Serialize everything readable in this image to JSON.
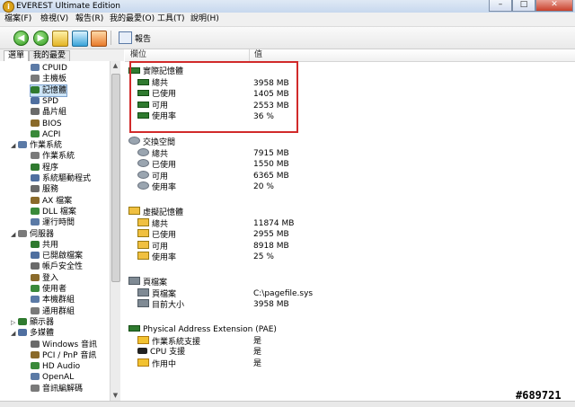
{
  "window": {
    "title": "EVEREST Ultimate Edition",
    "app_icon": "i",
    "min": "–",
    "max": "□",
    "close": "✕"
  },
  "menu": [
    "檔案(F)",
    "檢視(V)",
    "報告(R)",
    "我的最愛(O)",
    "工具(T)",
    "說明(H)"
  ],
  "toolbar": {
    "report_label": "報告",
    "back": "◀",
    "forward": "▶"
  },
  "tabs": {
    "menu": "選單",
    "favorites": "我的最愛"
  },
  "tree": [
    {
      "label": "CPUID",
      "icon": "cpu-icon",
      "indent": 2
    },
    {
      "label": "主機板",
      "icon": "motherboard-icon",
      "indent": 2
    },
    {
      "label": "記憶體",
      "icon": "memory-icon",
      "indent": 2,
      "selected": true
    },
    {
      "label": "SPD",
      "icon": "spd-icon",
      "indent": 2
    },
    {
      "label": "晶片組",
      "icon": "chipset-icon",
      "indent": 2
    },
    {
      "label": "BIOS",
      "icon": "bios-icon",
      "indent": 2
    },
    {
      "label": "ACPI",
      "icon": "acpi-icon",
      "indent": 2
    },
    {
      "label": "作業系統",
      "icon": "windows-icon",
      "indent": 1,
      "expander": "◢"
    },
    {
      "label": "作業系統",
      "icon": "windows-icon",
      "indent": 2
    },
    {
      "label": "程序",
      "icon": "process-icon",
      "indent": 2
    },
    {
      "label": "系統驅動程式",
      "icon": "driver-icon",
      "indent": 2
    },
    {
      "label": "服務",
      "icon": "service-icon",
      "indent": 2
    },
    {
      "label": "AX 檔案",
      "icon": "ax-icon",
      "indent": 2
    },
    {
      "label": "DLL 檔案",
      "icon": "dll-icon",
      "indent": 2
    },
    {
      "label": "運行時間",
      "icon": "clock-icon",
      "indent": 2
    },
    {
      "label": "伺服器",
      "icon": "server-icon",
      "indent": 1,
      "expander": "◢"
    },
    {
      "label": "共用",
      "icon": "share-icon",
      "indent": 2
    },
    {
      "label": "已開啟檔案",
      "icon": "file-icon",
      "indent": 2
    },
    {
      "label": "帳戶安全性",
      "icon": "security-icon",
      "indent": 2
    },
    {
      "label": "登入",
      "icon": "login-icon",
      "indent": 2
    },
    {
      "label": "使用者",
      "icon": "user-icon",
      "indent": 2
    },
    {
      "label": "本機群組",
      "icon": "group-icon",
      "indent": 2
    },
    {
      "label": "通用群組",
      "icon": "group-icon",
      "indent": 2
    },
    {
      "label": "顯示器",
      "icon": "display-icon",
      "indent": 1,
      "expander": "▷"
    },
    {
      "label": "多媒體",
      "icon": "multimedia-icon",
      "indent": 1,
      "expander": "◢"
    },
    {
      "label": "Windows 音訊",
      "icon": "audio-icon",
      "indent": 2
    },
    {
      "label": "PCI / PnP 音訊",
      "icon": "audio-icon",
      "indent": 2
    },
    {
      "label": "HD Audio",
      "icon": "audio-icon",
      "indent": 2
    },
    {
      "label": "OpenAL",
      "icon": "audio-icon",
      "indent": 2
    },
    {
      "label": "音訊編解碼",
      "icon": "codec-icon",
      "indent": 2
    }
  ],
  "columns": {
    "field": "欄位",
    "value": "值"
  },
  "sections": [
    {
      "title": "實際記憶體",
      "icon": "ram-icon",
      "kind": "ram",
      "rows": [
        {
          "label": "總共",
          "value": "3958 MB"
        },
        {
          "label": "已使用",
          "value": "1405 MB"
        },
        {
          "label": "可用",
          "value": "2553 MB"
        },
        {
          "label": "使用率",
          "value": "36 %"
        }
      ]
    },
    {
      "title": "交換空間",
      "icon": "swap-icon",
      "kind": "swap",
      "rows": [
        {
          "label": "總共",
          "value": "7915 MB"
        },
        {
          "label": "已使用",
          "value": "1550 MB"
        },
        {
          "label": "可用",
          "value": "6365 MB"
        },
        {
          "label": "使用率",
          "value": "20 %"
        }
      ]
    },
    {
      "title": "虛擬記憶體",
      "icon": "virtual-memory-icon",
      "kind": "virt",
      "rows": [
        {
          "label": "總共",
          "value": "11874 MB"
        },
        {
          "label": "已使用",
          "value": "2955 MB"
        },
        {
          "label": "可用",
          "value": "8918 MB"
        },
        {
          "label": "使用率",
          "value": "25 %"
        }
      ]
    },
    {
      "title": "頁檔案",
      "icon": "pagefile-icon",
      "kind": "page",
      "rows": [
        {
          "label": "頁檔案",
          "value": "C:\\pagefile.sys"
        },
        {
          "label": "目前大小",
          "value": "3958 MB"
        }
      ]
    },
    {
      "title": "Physical Address Extension (PAE)",
      "icon": "pae-icon",
      "kind": "ram",
      "rows": [
        {
          "label": "作業系統支援",
          "value": "是",
          "icon": "sys"
        },
        {
          "label": "CPU 支援",
          "value": "是",
          "icon": "cpu"
        },
        {
          "label": "作用中",
          "value": "是",
          "icon": "sys"
        }
      ]
    }
  ],
  "watermark": "#689721"
}
